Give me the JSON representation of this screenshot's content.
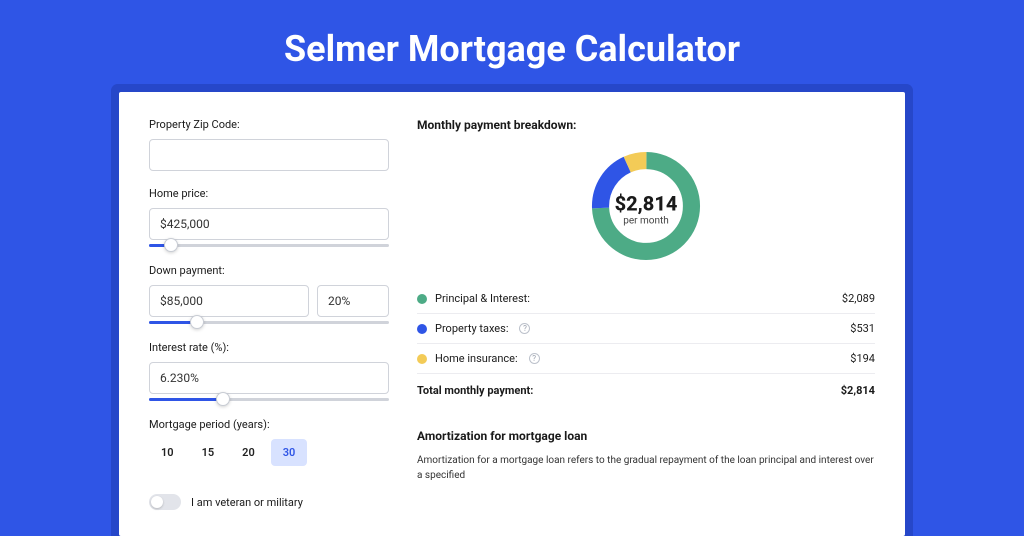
{
  "title": "Selmer Mortgage Calculator",
  "form": {
    "zip_label": "Property Zip Code:",
    "zip_value": "",
    "home_price_label": "Home price:",
    "home_price_value": "$425,000",
    "down_payment_label": "Down payment:",
    "down_payment_amount": "$85,000",
    "down_payment_percent": "20%",
    "interest_label": "Interest rate (%):",
    "interest_value": "6.230%",
    "period_label": "Mortgage period (years):",
    "period_options": [
      "10",
      "15",
      "20",
      "30"
    ],
    "period_selected": "30",
    "veteran_label": "I am veteran or military"
  },
  "breakdown": {
    "title": "Monthly payment breakdown:",
    "total_value": "$2,814",
    "per_month": "per month",
    "items": [
      {
        "label": "Principal & Interest:",
        "value": "$2,089",
        "color": "#4dab86",
        "info": false,
        "amount": 2089
      },
      {
        "label": "Property taxes:",
        "value": "$531",
        "color": "#2f55e6",
        "info": true,
        "amount": 531
      },
      {
        "label": "Home insurance:",
        "value": "$194",
        "color": "#f3cb57",
        "info": true,
        "amount": 194
      }
    ],
    "total_label": "Total monthly payment:"
  },
  "amort": {
    "title": "Amortization for mortgage loan",
    "text": "Amortization for a mortgage loan refers to the gradual repayment of the loan principal and interest over a specified"
  },
  "chart_data": {
    "type": "pie",
    "title": "Monthly payment breakdown",
    "categories": [
      "Principal & Interest",
      "Property taxes",
      "Home insurance"
    ],
    "values": [
      2089,
      531,
      194
    ],
    "colors": [
      "#4dab86",
      "#2f55e6",
      "#f3cb57"
    ],
    "total": 2814
  }
}
